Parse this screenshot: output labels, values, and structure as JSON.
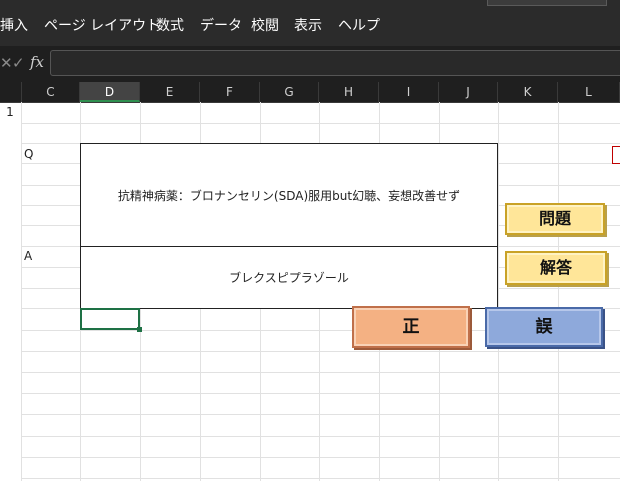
{
  "menu": {
    "items": [
      "挿入",
      "ページ レイアウト",
      "数式",
      "データ",
      "校閲",
      "表示",
      "ヘルプ"
    ]
  },
  "formula_bar": {
    "fx_label": "fx",
    "cancel_glyph": "✕",
    "enter_glyph": "✓",
    "value": ""
  },
  "columns": [
    "C",
    "D",
    "E",
    "F",
    "G",
    "H",
    "I",
    "J",
    "K",
    "L"
  ],
  "selected_column": "D",
  "rows": {
    "first_label": "1"
  },
  "cells": {
    "q_label": "Q",
    "a_label": "A"
  },
  "question_box": {
    "text": "抗精神病薬：ブロナンセリン(SDA)服用but幻聴、妄想改善せず"
  },
  "answer_box": {
    "text": "ブレクスピプラゾール"
  },
  "buttons": {
    "question": "問題",
    "answer": "解答",
    "correct": "正",
    "wrong": "誤"
  },
  "colors": {
    "menu_bg": "#2b2b2b",
    "btn_yellow": "#ffe699",
    "btn_salmon": "#f4b183",
    "btn_blue": "#8ea9db",
    "selection": "#1e7145"
  }
}
